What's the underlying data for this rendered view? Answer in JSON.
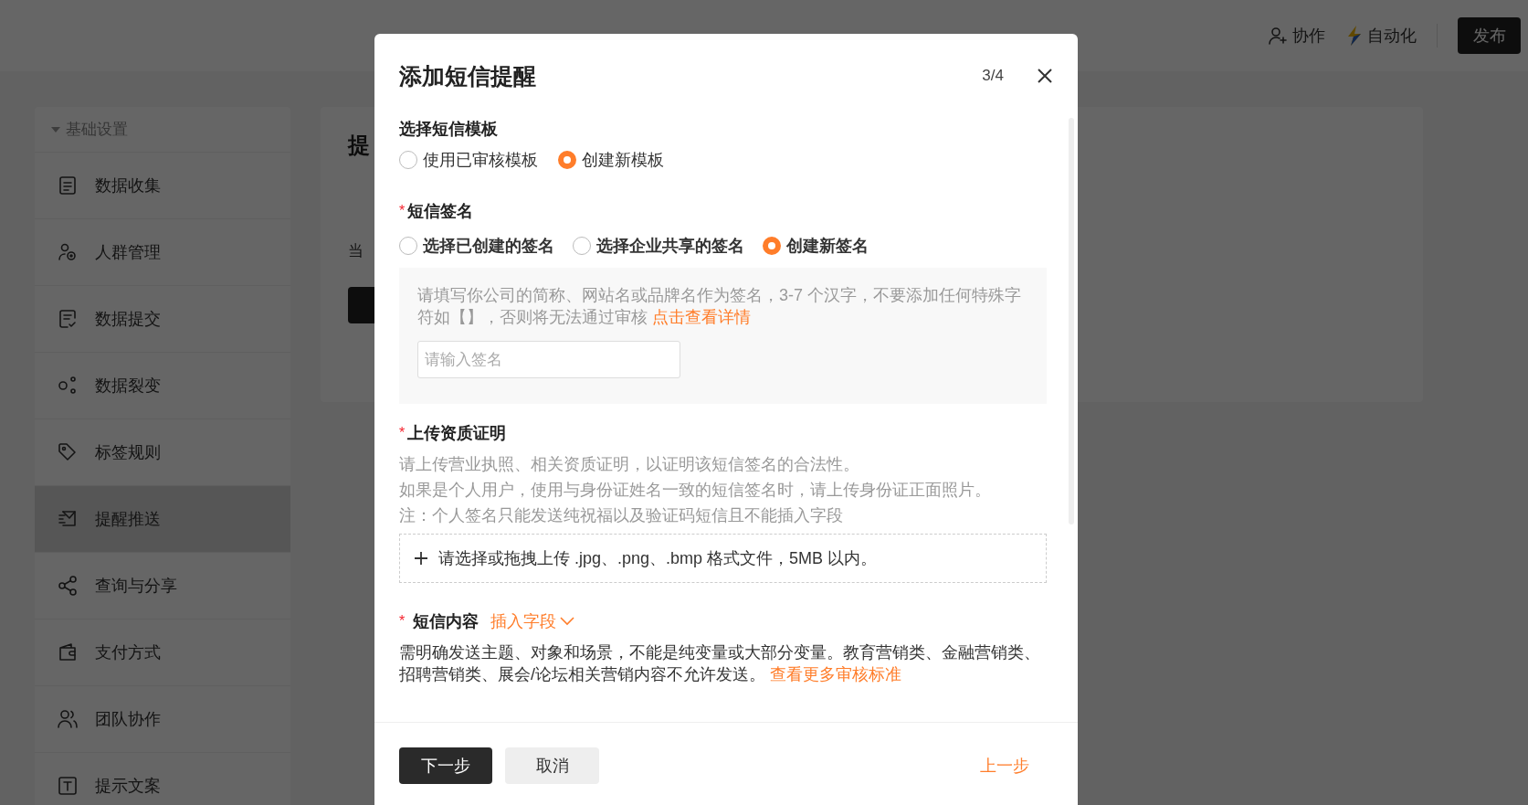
{
  "top_nav": {
    "actions": [
      {
        "label": "协作",
        "kind": "collab"
      },
      {
        "label": "自动化",
        "kind": "automation"
      }
    ],
    "publish_button": "发布"
  },
  "sidebar": {
    "group": "基础设置",
    "expanded": true,
    "items": [
      {
        "label": "数据收集",
        "selected": false
      },
      {
        "label": "人群管理",
        "selected": false
      },
      {
        "label": "数据提交",
        "selected": false
      },
      {
        "label": "数据裂变",
        "selected": false
      },
      {
        "label": "标签规则",
        "selected": false
      },
      {
        "label": "提醒推送",
        "selected": true
      },
      {
        "label": "查询与分享",
        "selected": false
      },
      {
        "label": "支付方式",
        "selected": false
      },
      {
        "label": "团队协作",
        "selected": false
      },
      {
        "label": "提示文案",
        "selected": false
      }
    ]
  },
  "card": {
    "title": "提",
    "text": "当"
  },
  "dialog": {
    "title": "添加短信提醒",
    "step": "3/4",
    "template": {
      "label": "选择短信模板",
      "options": [
        {
          "label": "使用已审核模板",
          "selected": false
        },
        {
          "label": "创建新模板",
          "selected": true
        }
      ]
    },
    "signature": {
      "label": "短信签名",
      "required_mark": "*",
      "options": [
        {
          "label": "选择已创建的签名",
          "selected": false
        },
        {
          "label": "选择企业共享的签名",
          "selected": false
        },
        {
          "label": "创建新签名",
          "selected": true
        }
      ],
      "hint": "请填写你公司的简称、网站名或品牌名作为签名，3-7 个汉字，不要添加任何特殊字符如【】，否则将无法通过审核",
      "hint_link": "点击查看详情",
      "input": {
        "placeholder": "请输入签名"
      }
    },
    "qualification": {
      "label": "上传资质证明",
      "required_mark": "*",
      "notes": [
        "请上传营业执照、相关资质证明，以证明该短信签名的合法性。",
        "如果是个人用户，使用与身份证姓名一致的短信签名时，请上传身份证正面照片。",
        "注：个人签名只能发送纯祝福以及验证码短信且不能插入字段"
      ],
      "upload": "请选择或拖拽上传 .jpg、.png、.bmp 格式文件，5MB 以内。"
    },
    "content": {
      "label": "短信内容",
      "required_mark": "*",
      "insert_field": "插入字段",
      "note": "需明确发送主题、对象和场景，不能是纯变量或大部分变量。教育营销类、金融营销类、招聘营销类、展会/论坛相关营销内容不允许发送。",
      "note_link": "查看更多审核标准"
    },
    "footer": {
      "next": "下一步",
      "cancel": "取消",
      "prev": "上一步"
    }
  }
}
